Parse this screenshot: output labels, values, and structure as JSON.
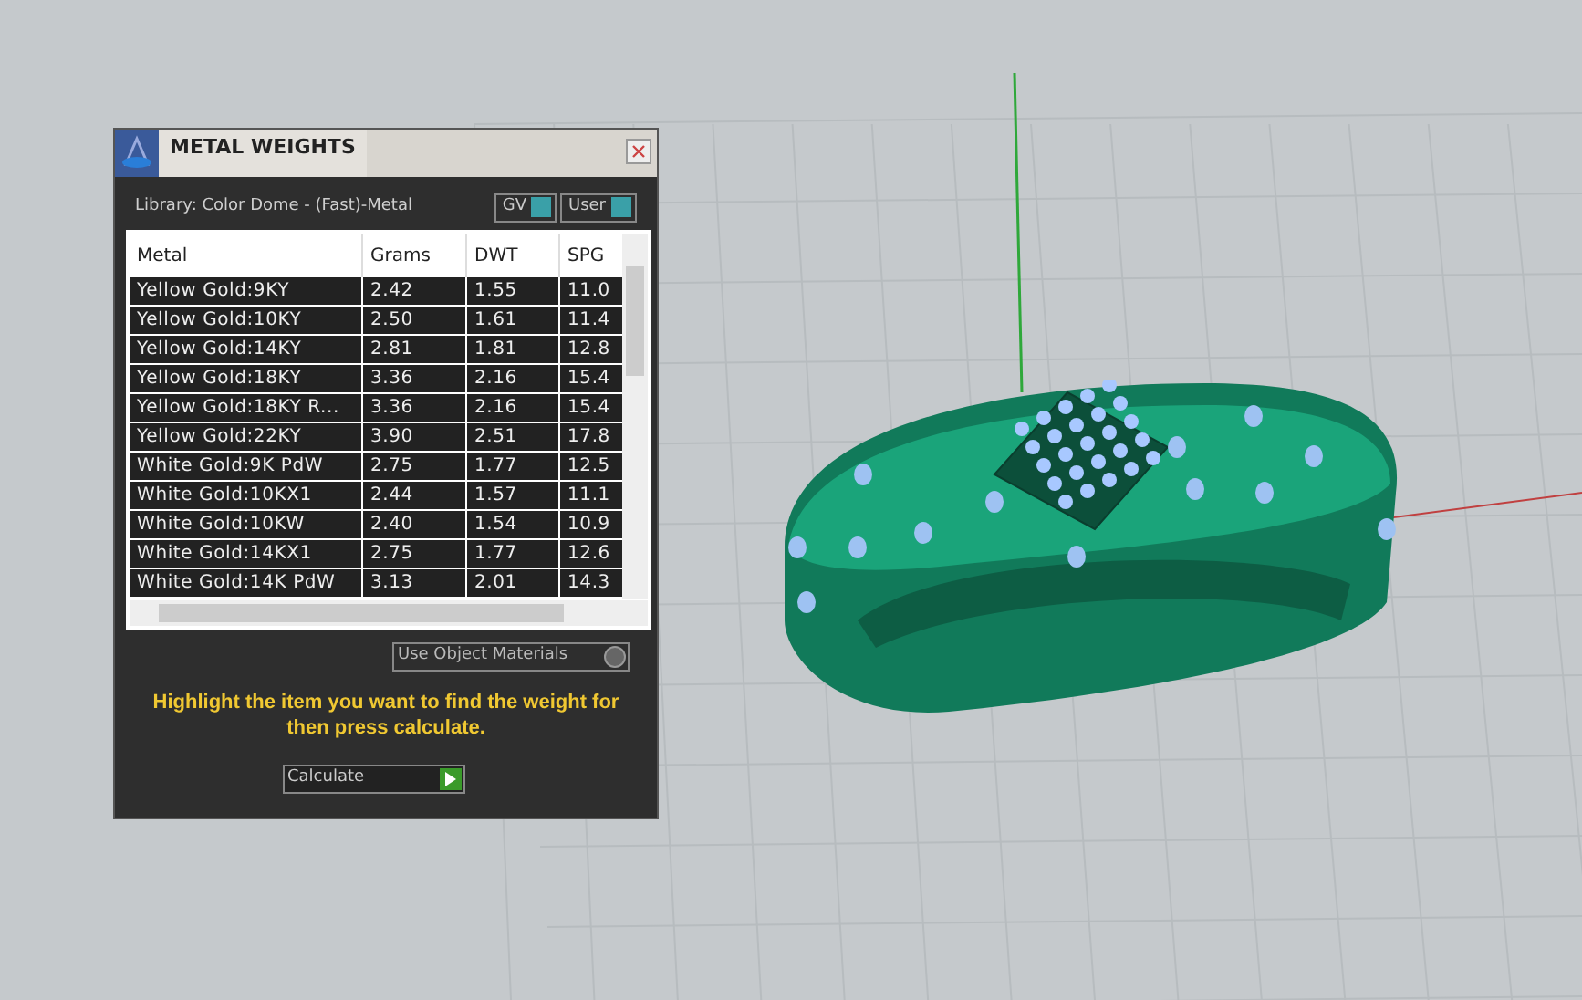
{
  "window": {
    "title": "METAL WEIGHTS"
  },
  "library": "Library: Color Dome - (Fast)-Metal",
  "toggles": [
    {
      "label": "GV",
      "on": true
    },
    {
      "label": "User",
      "on": true
    }
  ],
  "table": {
    "columns": [
      "Metal",
      "Grams",
      "DWT",
      "SPG"
    ],
    "rows": [
      {
        "cells": [
          "Yellow Gold:9KY",
          "2.42",
          "1.55",
          "11.0"
        ],
        "selected": false
      },
      {
        "cells": [
          "Yellow Gold:10KY",
          "2.50",
          "1.61",
          "11.4"
        ],
        "selected": false
      },
      {
        "cells": [
          "Yellow Gold:14KY",
          "2.81",
          "1.81",
          "12.8"
        ],
        "selected": false
      },
      {
        "cells": [
          "Yellow Gold:18KY",
          "3.36",
          "2.16",
          "15.4"
        ],
        "selected": false
      },
      {
        "cells": [
          "Yellow Gold:18KY R...",
          "3.36",
          "2.16",
          "15.4"
        ],
        "selected": false
      },
      {
        "cells": [
          "Yellow Gold:22KY",
          "3.90",
          "2.51",
          "17.8"
        ],
        "selected": false
      },
      {
        "cells": [
          "White Gold:9K PdW",
          "2.75",
          "1.77",
          "12.5"
        ],
        "selected": false
      },
      {
        "cells": [
          "White Gold:10KX1",
          "2.44",
          "1.57",
          "11.1"
        ],
        "selected": false
      },
      {
        "cells": [
          "White Gold:10KW",
          "2.40",
          "1.54",
          "10.9"
        ],
        "selected": false
      },
      {
        "cells": [
          "White Gold:14KX1",
          "2.75",
          "1.77",
          "12.6"
        ],
        "selected": false
      },
      {
        "cells": [
          "White Gold:14K PdW",
          "3.13",
          "2.01",
          "14.3"
        ],
        "selected": false
      }
    ]
  },
  "use_object_materials": {
    "label": "Use Object Materials",
    "checked": false
  },
  "hint": "Highlight the item you want to find the weight for then press calculate.",
  "calculate_button": "Calculate"
}
